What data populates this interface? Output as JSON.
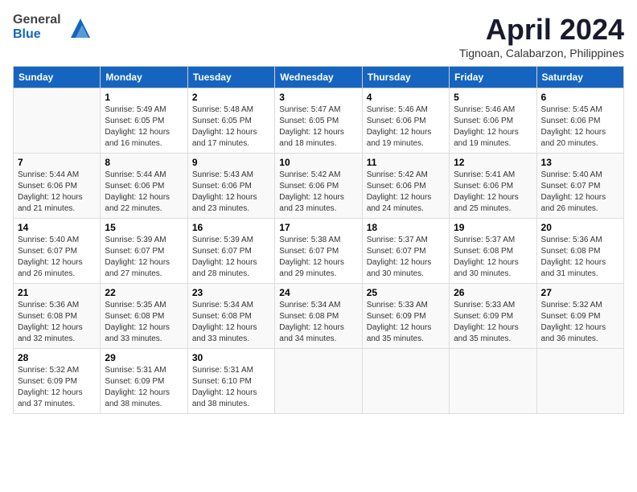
{
  "header": {
    "logo_line1": "General",
    "logo_line2": "Blue",
    "month_title": "April 2024",
    "subtitle": "Tignoan, Calabarzon, Philippines"
  },
  "weekdays": [
    "Sunday",
    "Monday",
    "Tuesday",
    "Wednesday",
    "Thursday",
    "Friday",
    "Saturday"
  ],
  "weeks": [
    [
      {
        "day": "",
        "info": ""
      },
      {
        "day": "1",
        "info": "Sunrise: 5:49 AM\nSunset: 6:05 PM\nDaylight: 12 hours\nand 16 minutes."
      },
      {
        "day": "2",
        "info": "Sunrise: 5:48 AM\nSunset: 6:05 PM\nDaylight: 12 hours\nand 17 minutes."
      },
      {
        "day": "3",
        "info": "Sunrise: 5:47 AM\nSunset: 6:05 PM\nDaylight: 12 hours\nand 18 minutes."
      },
      {
        "day": "4",
        "info": "Sunrise: 5:46 AM\nSunset: 6:06 PM\nDaylight: 12 hours\nand 19 minutes."
      },
      {
        "day": "5",
        "info": "Sunrise: 5:46 AM\nSunset: 6:06 PM\nDaylight: 12 hours\nand 19 minutes."
      },
      {
        "day": "6",
        "info": "Sunrise: 5:45 AM\nSunset: 6:06 PM\nDaylight: 12 hours\nand 20 minutes."
      }
    ],
    [
      {
        "day": "7",
        "info": "Sunrise: 5:44 AM\nSunset: 6:06 PM\nDaylight: 12 hours\nand 21 minutes."
      },
      {
        "day": "8",
        "info": "Sunrise: 5:44 AM\nSunset: 6:06 PM\nDaylight: 12 hours\nand 22 minutes."
      },
      {
        "day": "9",
        "info": "Sunrise: 5:43 AM\nSunset: 6:06 PM\nDaylight: 12 hours\nand 23 minutes."
      },
      {
        "day": "10",
        "info": "Sunrise: 5:42 AM\nSunset: 6:06 PM\nDaylight: 12 hours\nand 23 minutes."
      },
      {
        "day": "11",
        "info": "Sunrise: 5:42 AM\nSunset: 6:06 PM\nDaylight: 12 hours\nand 24 minutes."
      },
      {
        "day": "12",
        "info": "Sunrise: 5:41 AM\nSunset: 6:06 PM\nDaylight: 12 hours\nand 25 minutes."
      },
      {
        "day": "13",
        "info": "Sunrise: 5:40 AM\nSunset: 6:07 PM\nDaylight: 12 hours\nand 26 minutes."
      }
    ],
    [
      {
        "day": "14",
        "info": "Sunrise: 5:40 AM\nSunset: 6:07 PM\nDaylight: 12 hours\nand 26 minutes."
      },
      {
        "day": "15",
        "info": "Sunrise: 5:39 AM\nSunset: 6:07 PM\nDaylight: 12 hours\nand 27 minutes."
      },
      {
        "day": "16",
        "info": "Sunrise: 5:39 AM\nSunset: 6:07 PM\nDaylight: 12 hours\nand 28 minutes."
      },
      {
        "day": "17",
        "info": "Sunrise: 5:38 AM\nSunset: 6:07 PM\nDaylight: 12 hours\nand 29 minutes."
      },
      {
        "day": "18",
        "info": "Sunrise: 5:37 AM\nSunset: 6:07 PM\nDaylight: 12 hours\nand 30 minutes."
      },
      {
        "day": "19",
        "info": "Sunrise: 5:37 AM\nSunset: 6:08 PM\nDaylight: 12 hours\nand 30 minutes."
      },
      {
        "day": "20",
        "info": "Sunrise: 5:36 AM\nSunset: 6:08 PM\nDaylight: 12 hours\nand 31 minutes."
      }
    ],
    [
      {
        "day": "21",
        "info": "Sunrise: 5:36 AM\nSunset: 6:08 PM\nDaylight: 12 hours\nand 32 minutes."
      },
      {
        "day": "22",
        "info": "Sunrise: 5:35 AM\nSunset: 6:08 PM\nDaylight: 12 hours\nand 33 minutes."
      },
      {
        "day": "23",
        "info": "Sunrise: 5:34 AM\nSunset: 6:08 PM\nDaylight: 12 hours\nand 33 minutes."
      },
      {
        "day": "24",
        "info": "Sunrise: 5:34 AM\nSunset: 6:08 PM\nDaylight: 12 hours\nand 34 minutes."
      },
      {
        "day": "25",
        "info": "Sunrise: 5:33 AM\nSunset: 6:09 PM\nDaylight: 12 hours\nand 35 minutes."
      },
      {
        "day": "26",
        "info": "Sunrise: 5:33 AM\nSunset: 6:09 PM\nDaylight: 12 hours\nand 35 minutes."
      },
      {
        "day": "27",
        "info": "Sunrise: 5:32 AM\nSunset: 6:09 PM\nDaylight: 12 hours\nand 36 minutes."
      }
    ],
    [
      {
        "day": "28",
        "info": "Sunrise: 5:32 AM\nSunset: 6:09 PM\nDaylight: 12 hours\nand 37 minutes."
      },
      {
        "day": "29",
        "info": "Sunrise: 5:31 AM\nSunset: 6:09 PM\nDaylight: 12 hours\nand 38 minutes."
      },
      {
        "day": "30",
        "info": "Sunrise: 5:31 AM\nSunset: 6:10 PM\nDaylight: 12 hours\nand 38 minutes."
      },
      {
        "day": "",
        "info": ""
      },
      {
        "day": "",
        "info": ""
      },
      {
        "day": "",
        "info": ""
      },
      {
        "day": "",
        "info": ""
      }
    ]
  ]
}
